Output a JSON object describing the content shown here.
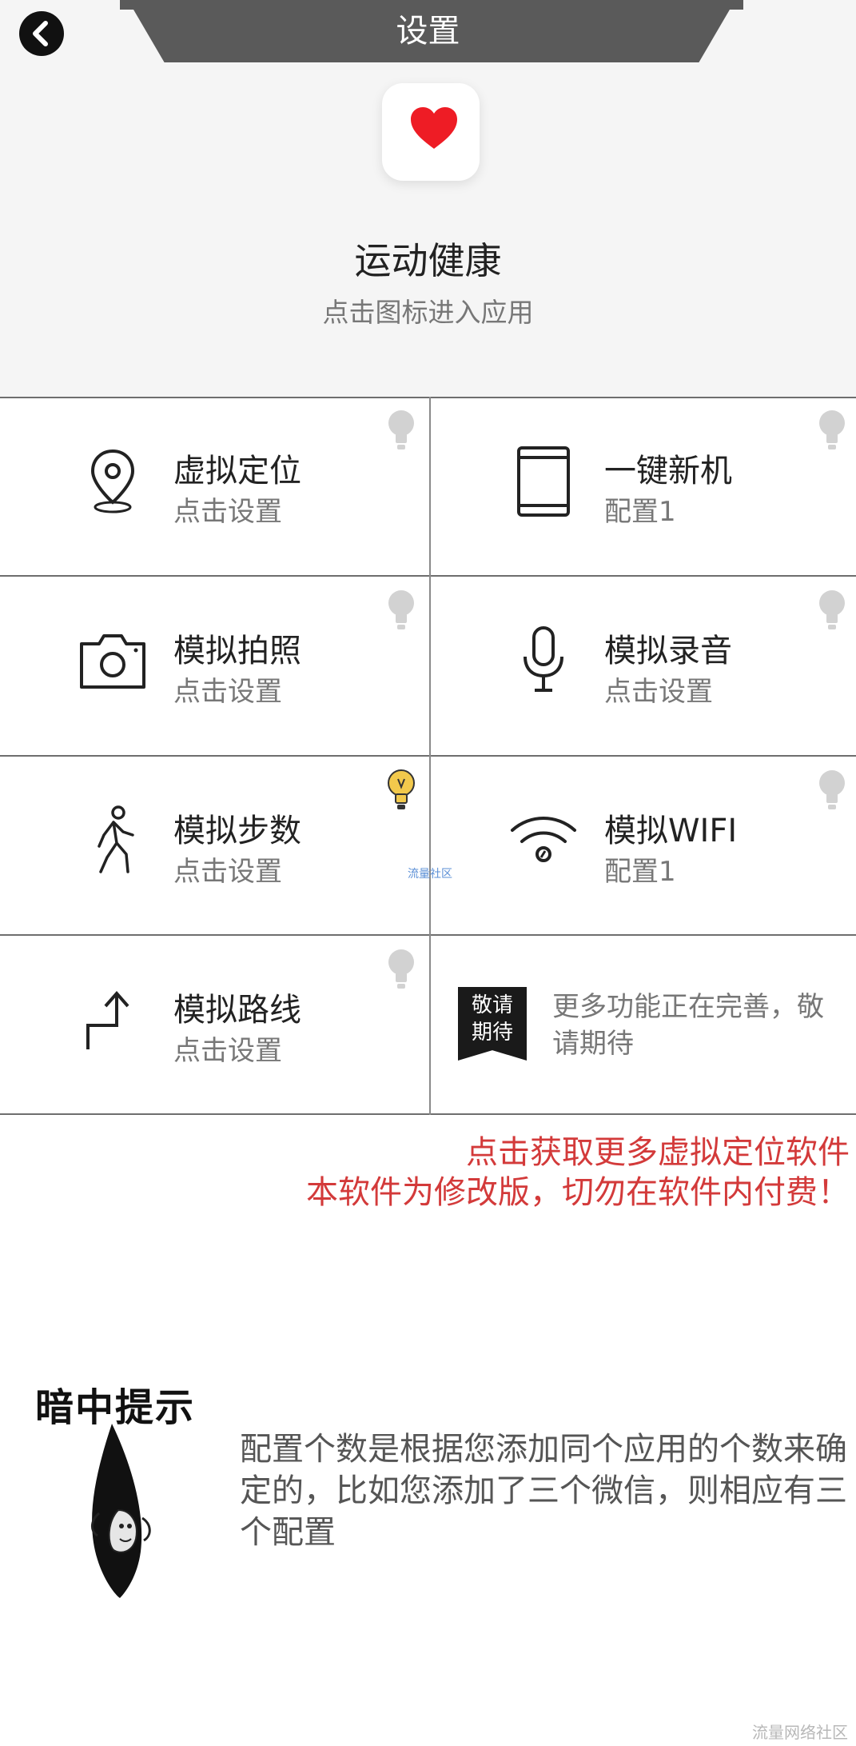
{
  "header": {
    "title": "设置"
  },
  "app": {
    "name": "运动健康",
    "hint": "点击图标进入应用"
  },
  "features": [
    {
      "title": "虚拟定位",
      "subtitle": "点击设置",
      "icon": "location-pin-icon",
      "bulb_lit": false
    },
    {
      "title": "一键新机",
      "subtitle": "配置1",
      "icon": "phone-icon",
      "bulb_lit": false
    },
    {
      "title": "模拟拍照",
      "subtitle": "点击设置",
      "icon": "camera-icon",
      "bulb_lit": false
    },
    {
      "title": "模拟录音",
      "subtitle": "点击设置",
      "icon": "microphone-icon",
      "bulb_lit": false
    },
    {
      "title": "模拟步数",
      "subtitle": "点击设置",
      "icon": "walking-person-icon",
      "bulb_lit": true
    },
    {
      "title": "模拟WIFI",
      "subtitle": "配置1",
      "icon": "wifi-icon",
      "bulb_lit": false
    },
    {
      "title": "模拟路线",
      "subtitle": "点击设置",
      "icon": "route-arrow-icon",
      "bulb_lit": false
    }
  ],
  "coming_soon": {
    "badge_line1": "敬请",
    "badge_line2": "期待",
    "text": "更多功能正在完善，敬请期待"
  },
  "watermark_mid": "流量社区",
  "promo": {
    "line1": "点击获取更多虚拟定位软件",
    "line2": "本软件为修改版，切勿在软件内付费！"
  },
  "tip": {
    "heading": "暗中提示",
    "text": "配置个数是根据您添加同个应用的个数来确定的，比如您添加了三个微信，则相应有三个配置"
  },
  "watermark_bottom": "流量网络社区",
  "colors": {
    "header_bg": "#5a5a5a",
    "hero_bg": "#f5f5f5",
    "promo_red": "#d33a3a",
    "heart_red": "#ee1c25",
    "bulb_lit": "#f2c94c",
    "bulb_off": "#d2d2d2"
  }
}
